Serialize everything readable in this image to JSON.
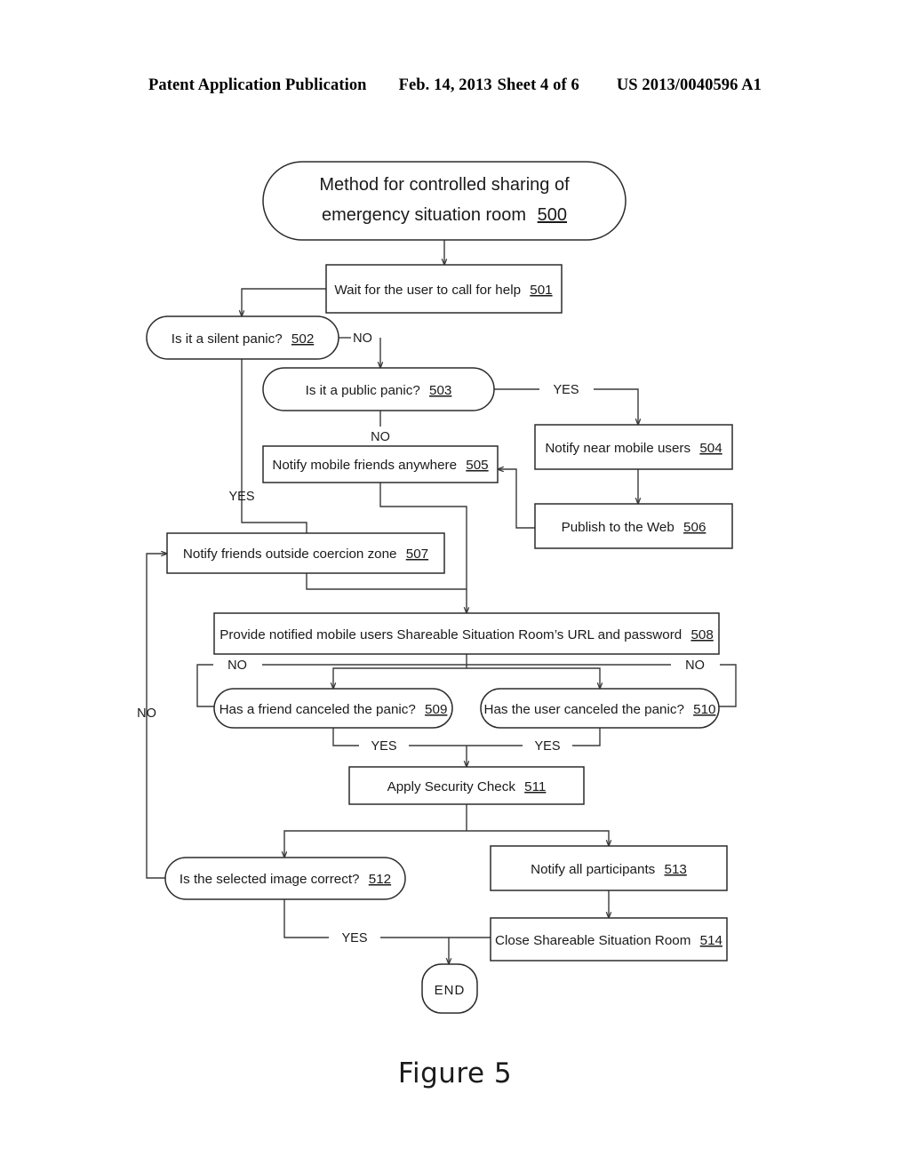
{
  "header": {
    "publication": "Patent Application Publication",
    "date": "Feb. 14, 2013",
    "sheet": "Sheet 4 of 6",
    "number": "US 2013/0040596 A1"
  },
  "figure": {
    "caption": "Figure 5"
  },
  "chart_data": {
    "type": "diagram",
    "subtype": "flowchart",
    "title": "Method for controlled sharing of emergency situation room 500",
    "nodes": [
      {
        "id": "500",
        "ref": "500",
        "shape": "stadium",
        "text_line1": "Method for controlled sharing of",
        "text_line2": "emergency situation room",
        "label": "Method for controlled sharing of emergency situation room 500"
      },
      {
        "id": "501",
        "ref": "501",
        "shape": "rect",
        "label": "Wait for the user to call for help 501",
        "text": "Wait for the user to call for help"
      },
      {
        "id": "502",
        "ref": "502",
        "shape": "stadium",
        "label": "Is it a silent panic? 502",
        "text": "Is it a silent panic?"
      },
      {
        "id": "503",
        "ref": "503",
        "shape": "stadium",
        "label": "Is it a public panic? 503",
        "text": "Is it a public panic?"
      },
      {
        "id": "504",
        "ref": "504",
        "shape": "rect",
        "label": "Notify near mobile users 504",
        "text": "Notify near mobile users"
      },
      {
        "id": "505",
        "ref": "505",
        "shape": "rect",
        "label": "Notify mobile friends anywhere 505",
        "text": "Notify mobile friends anywhere"
      },
      {
        "id": "506",
        "ref": "506",
        "shape": "rect",
        "label": "Publish to the Web 506",
        "text": "Publish to the Web"
      },
      {
        "id": "507",
        "ref": "507",
        "shape": "rect",
        "label": "Notify friends outside coercion zone 507",
        "text": "Notify friends outside coercion zone"
      },
      {
        "id": "508",
        "ref": "508",
        "shape": "rect",
        "label": "Provide notified mobile users Shareable Situation Room’s URL and password 508",
        "text": "Provide notified mobile users Shareable Situation Room’s URL and password"
      },
      {
        "id": "509",
        "ref": "509",
        "shape": "stadium",
        "label": "Has a friend canceled the panic? 509",
        "text": "Has a friend canceled the panic?"
      },
      {
        "id": "510",
        "ref": "510",
        "shape": "stadium",
        "label": "Has the user canceled the panic? 510",
        "text": "Has the user canceled the panic?"
      },
      {
        "id": "511",
        "ref": "511",
        "shape": "rect",
        "label": "Apply Security Check 511",
        "text": "Apply Security Check"
      },
      {
        "id": "512",
        "ref": "512",
        "shape": "stadium",
        "label": "Is the selected image correct? 512",
        "text": "Is the selected image correct?"
      },
      {
        "id": "513",
        "ref": "513",
        "shape": "rect",
        "label": "Notify all participants 513",
        "text": "Notify all participants"
      },
      {
        "id": "514",
        "ref": "514",
        "shape": "rect",
        "label": "Close Shareable Situation Room 514",
        "text": "Close Shareable Situation Room"
      },
      {
        "id": "end",
        "ref": "",
        "shape": "terminal",
        "label": "END",
        "text": "END"
      }
    ],
    "edges": [
      {
        "from": "500",
        "to": "501",
        "label": ""
      },
      {
        "from": "501",
        "to": "502",
        "label": ""
      },
      {
        "from": "502",
        "to": "503",
        "label": "NO"
      },
      {
        "from": "502",
        "to": "507",
        "label": "YES"
      },
      {
        "from": "503",
        "to": "505",
        "label": "NO"
      },
      {
        "from": "503",
        "to": "504",
        "label": "YES"
      },
      {
        "from": "504",
        "to": "506",
        "label": ""
      },
      {
        "from": "506",
        "to": "505",
        "label": ""
      },
      {
        "from": "505",
        "to": "508",
        "label": ""
      },
      {
        "from": "507",
        "to": "508",
        "label": ""
      },
      {
        "from": "508",
        "to": "509",
        "label": ""
      },
      {
        "from": "508",
        "to": "510",
        "label": ""
      },
      {
        "from": "509",
        "to": "508",
        "label": "NO"
      },
      {
        "from": "510",
        "to": "508",
        "label": "NO"
      },
      {
        "from": "509",
        "to": "511",
        "label": "YES"
      },
      {
        "from": "510",
        "to": "511",
        "label": "YES"
      },
      {
        "from": "511",
        "to": "512",
        "label": ""
      },
      {
        "from": "511",
        "to": "513",
        "label": ""
      },
      {
        "from": "512",
        "to": "507",
        "label": "NO"
      },
      {
        "from": "512",
        "to": "end",
        "label": "YES"
      },
      {
        "from": "513",
        "to": "514",
        "label": ""
      },
      {
        "from": "514",
        "to": "end",
        "label": ""
      }
    ],
    "edge_labels": {
      "e502_no": "NO",
      "e502_yes": "YES",
      "e503_no": "NO",
      "e503_yes": "YES",
      "e509_no": "NO",
      "e510_no": "NO",
      "e509_yes": "YES",
      "e510_yes": "YES",
      "e512_no": "NO",
      "e512_yes": "YES"
    }
  }
}
